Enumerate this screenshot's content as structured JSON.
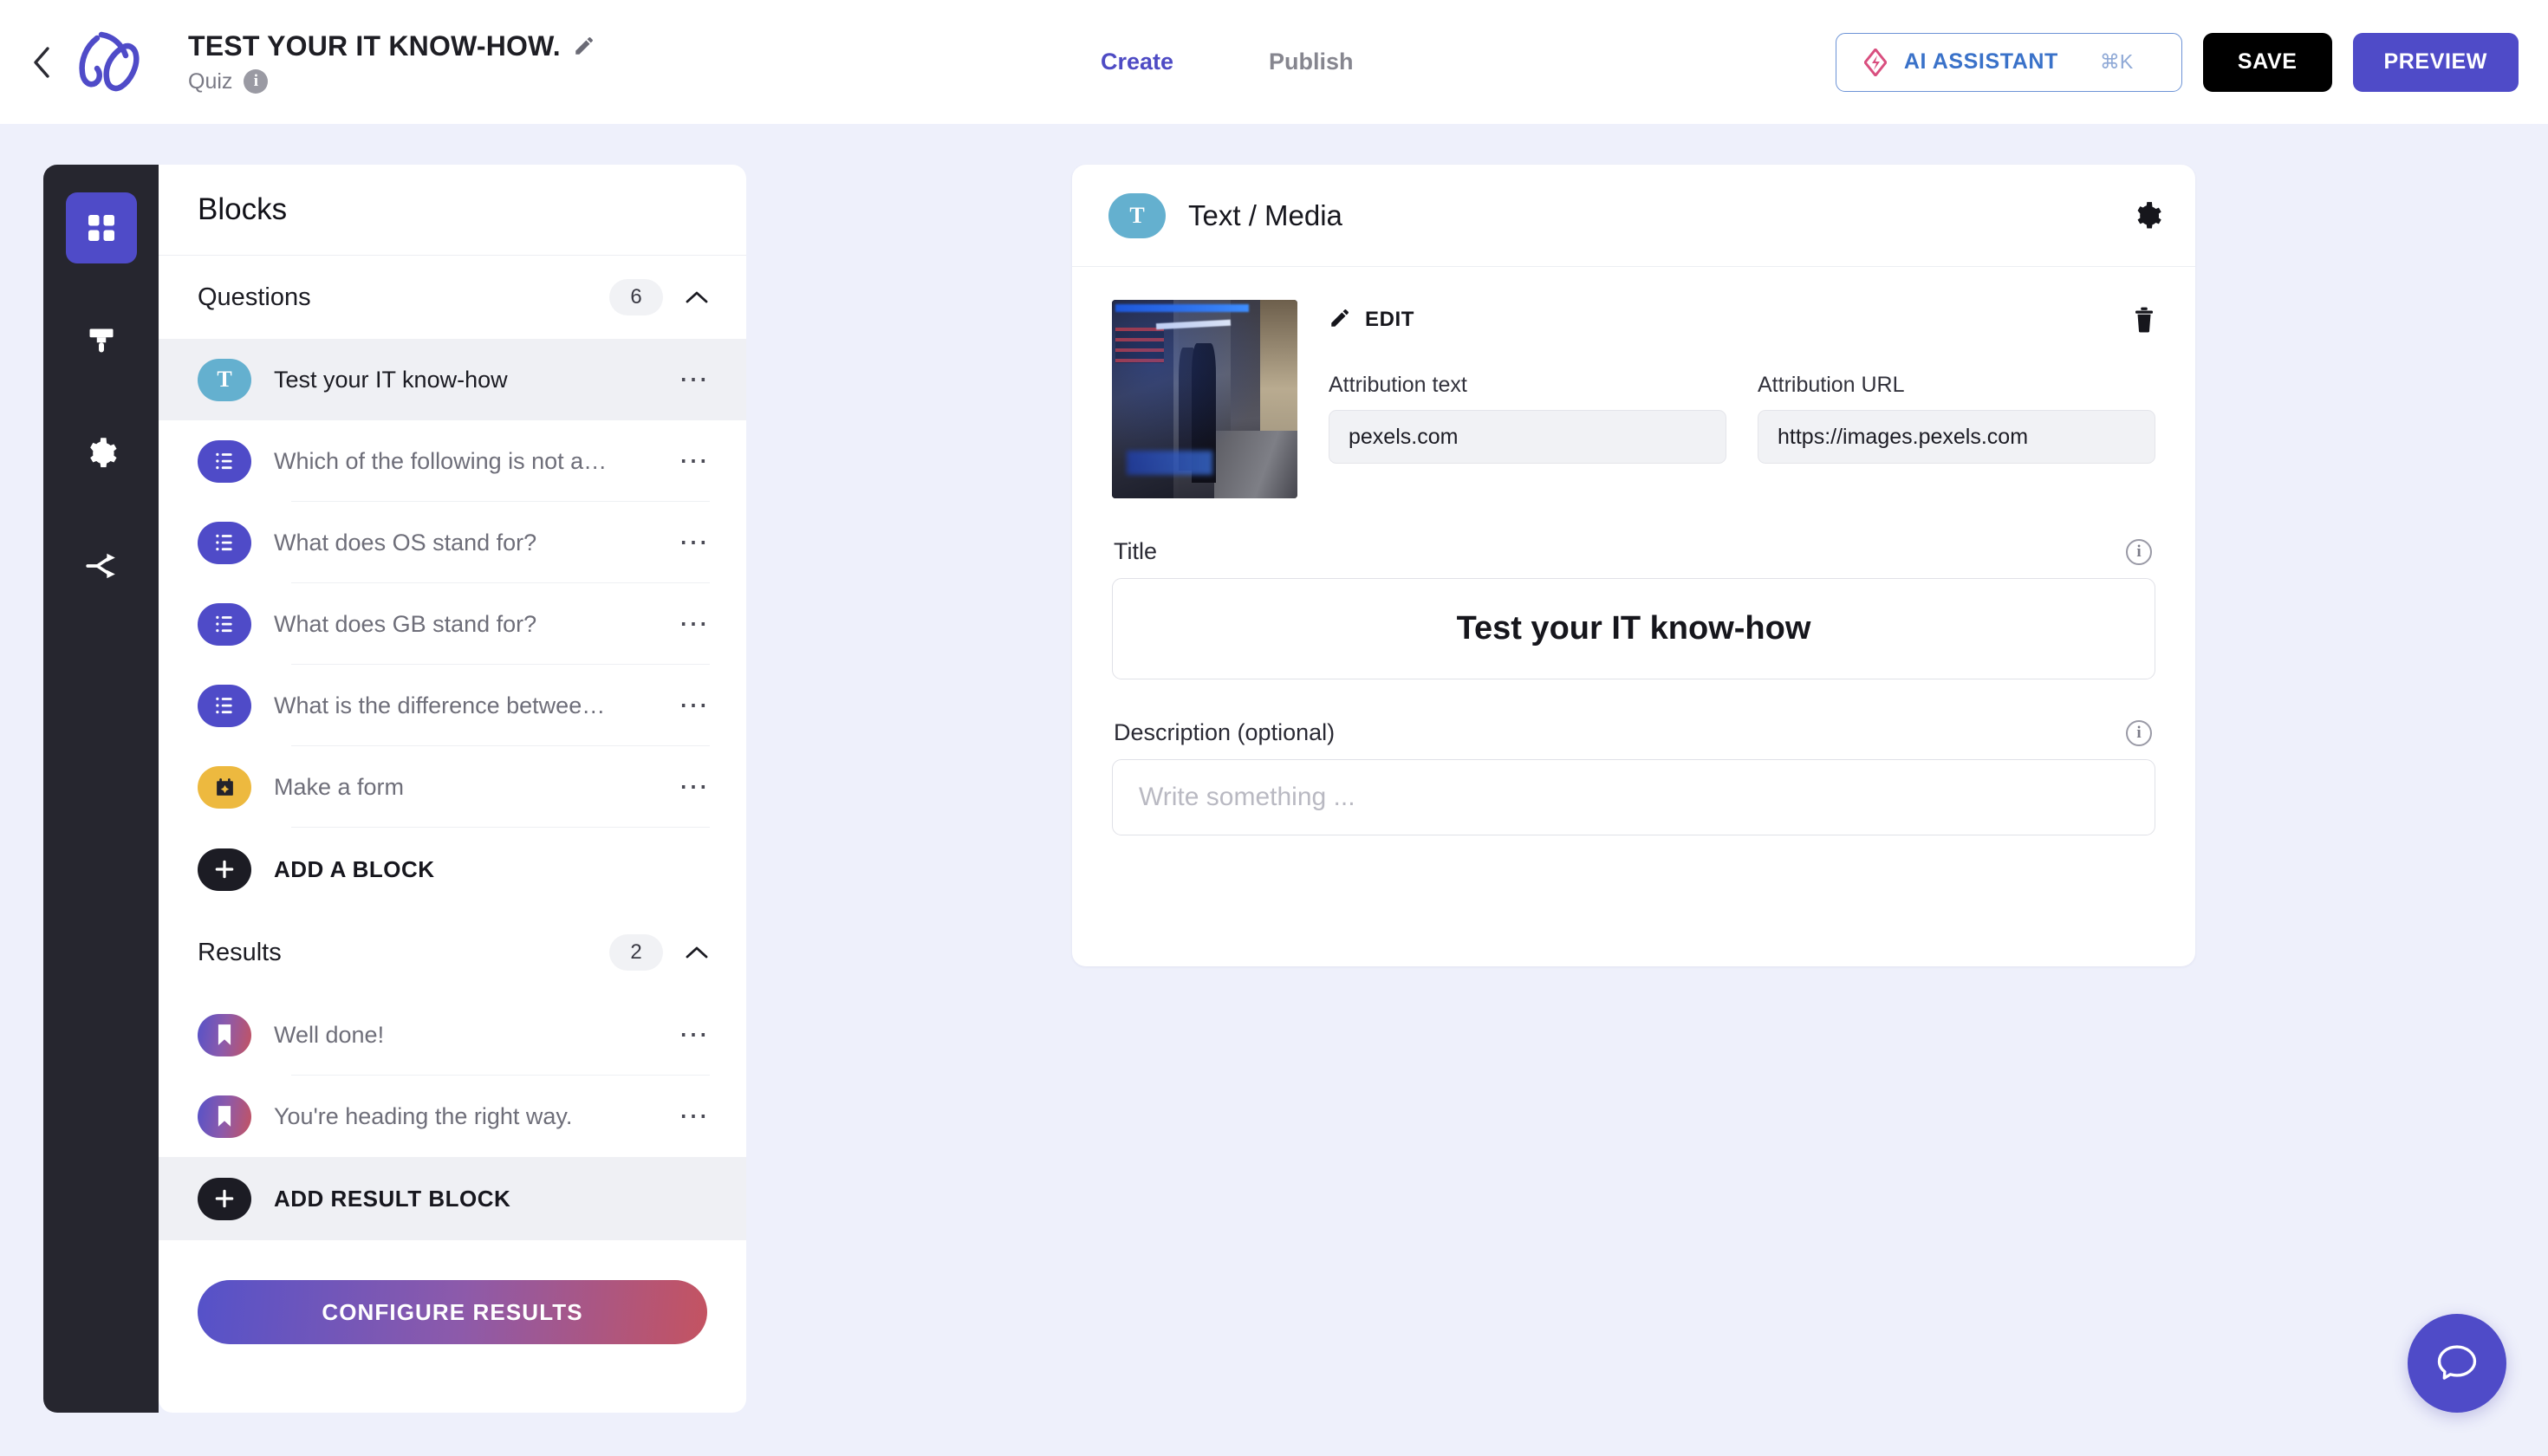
{
  "header": {
    "back_icon": "chevron-left-icon",
    "logo_icon": "app-logo-icon",
    "doc_title": "TEST YOUR IT KNOW-HOW.",
    "edit_icon": "pencil-icon",
    "doc_type": "Quiz",
    "info_icon": "info-icon",
    "tabs": [
      {
        "label": "Create",
        "active": true
      },
      {
        "label": "Publish",
        "active": false
      }
    ],
    "ai_button": {
      "label": "AI ASSISTANT",
      "shortcut": "⌘K",
      "icon": "ai-diamond-icon"
    },
    "save_label": "SAVE",
    "preview_label": "PREVIEW"
  },
  "rail": {
    "items": [
      {
        "icon": "blocks-grid-icon",
        "name": "blocks",
        "active": true
      },
      {
        "icon": "paint-brush-icon",
        "name": "design",
        "active": false
      },
      {
        "icon": "gear-icon",
        "name": "settings",
        "active": false
      },
      {
        "icon": "share-branch-icon",
        "name": "share",
        "active": false
      }
    ]
  },
  "blocks_panel": {
    "title": "Blocks",
    "questions_section": {
      "label": "Questions",
      "count": "6",
      "collapse_icon": "chevron-up-icon",
      "items": [
        {
          "label": "Test your IT know-how",
          "icon": "text-block-icon",
          "icon_type": "text",
          "icon_glyph": "T",
          "selected": true
        },
        {
          "label": "Which of the following is not a…",
          "icon": "choice-block-icon",
          "icon_type": "choice",
          "selected": false
        },
        {
          "label": "What does OS stand for?",
          "icon": "choice-block-icon",
          "icon_type": "choice",
          "selected": false
        },
        {
          "label": "What does GB stand for?",
          "icon": "choice-block-icon",
          "icon_type": "choice",
          "selected": false
        },
        {
          "label": "What is the difference betwee…",
          "icon": "choice-block-icon",
          "icon_type": "choice",
          "selected": false
        },
        {
          "label": "Make a form",
          "icon": "form-block-icon",
          "icon_type": "form",
          "selected": false
        }
      ],
      "add_label": "ADD A BLOCK",
      "add_icon": "plus-icon"
    },
    "results_section": {
      "label": "Results",
      "count": "2",
      "collapse_icon": "chevron-up-icon",
      "items": [
        {
          "label": "Well done!",
          "icon": "result-bookmark-icon",
          "icon_type": "result"
        },
        {
          "label": "You're heading the right way.",
          "icon": "result-bookmark-icon",
          "icon_type": "result"
        }
      ],
      "add_label": "ADD RESULT BLOCK",
      "add_icon": "plus-icon"
    },
    "configure_label": "CONFIGURE RESULTS",
    "row_menu_icon": "ellipsis-icon"
  },
  "editor": {
    "badge_glyph": "T",
    "title": "Text / Media",
    "settings_icon": "gear-icon",
    "media": {
      "edit_label": "EDIT",
      "edit_icon": "pencil-icon",
      "delete_icon": "trash-icon",
      "thumbnail_alt": "server-room-photo",
      "attribution_text_label": "Attribution text",
      "attribution_text_value": "pexels.com",
      "attribution_url_label": "Attribution URL",
      "attribution_url_value": "https://images.pexels.com"
    },
    "title_field": {
      "label": "Title",
      "value": "Test your IT know-how",
      "info_icon": "info-icon"
    },
    "description_field": {
      "label": "Description (optional)",
      "placeholder": "Write something ...",
      "value": "",
      "info_icon": "info-icon"
    }
  },
  "chat": {
    "icon": "chat-bubble-icon"
  },
  "colors": {
    "app_background": "#eef0fb",
    "brand_purple": "#4f4bc8",
    "rail_dark": "#26262f",
    "text_block_blue": "#64b0cf",
    "form_block_yellow": "#edb93f",
    "ai_blue": "#3a72c9",
    "ai_diamond_pink": "#d94f7f"
  }
}
